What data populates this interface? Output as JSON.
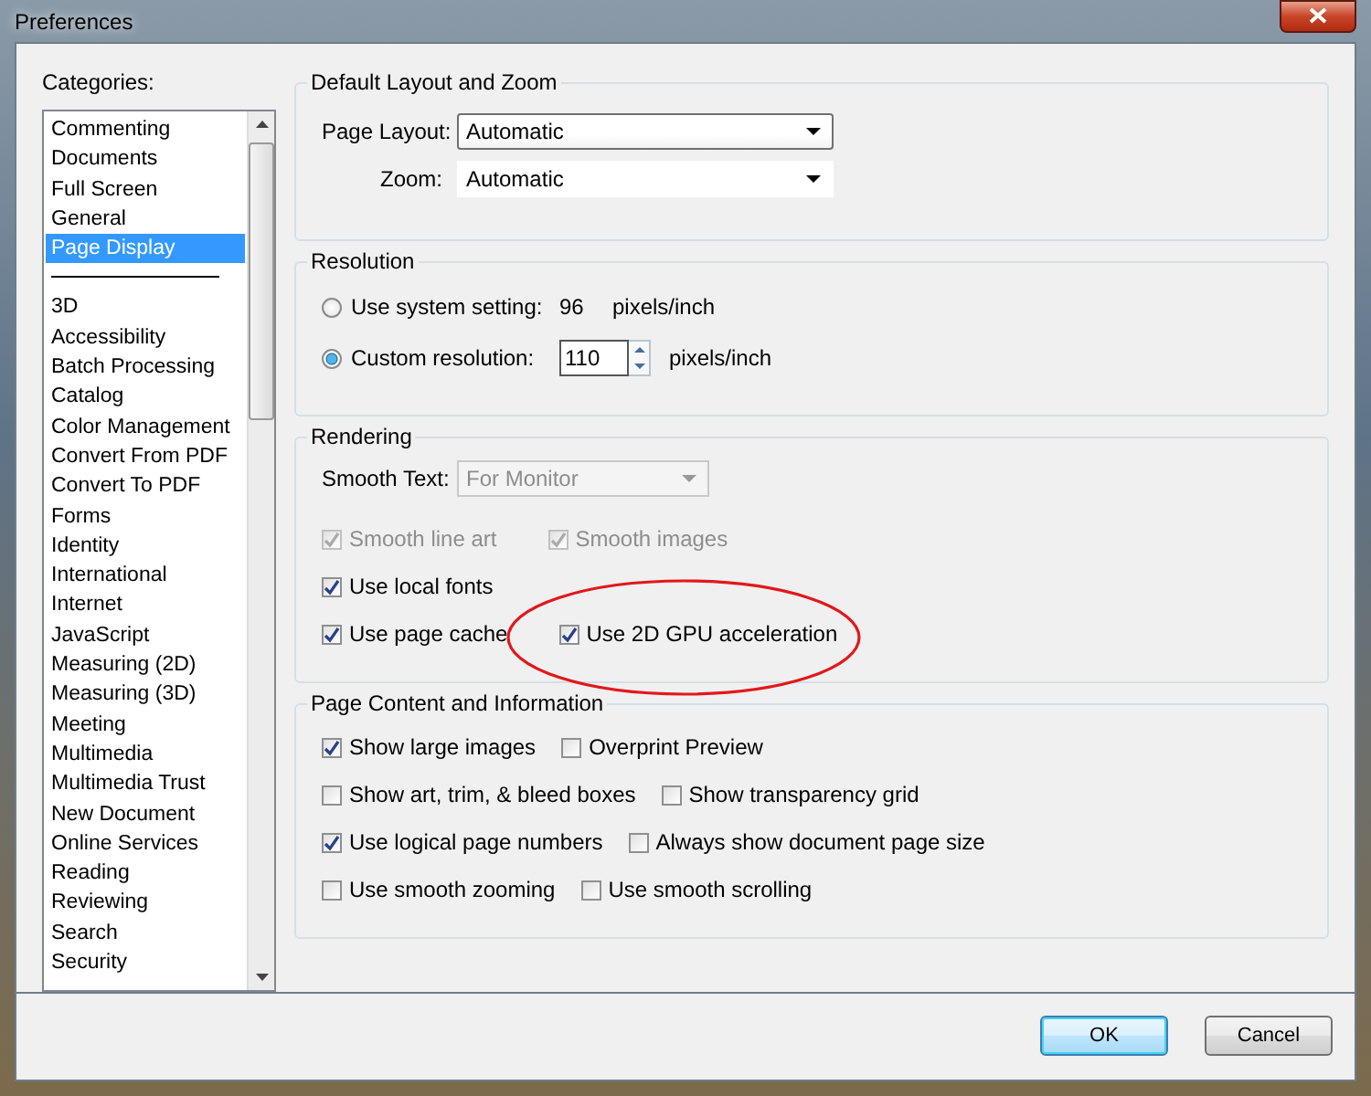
{
  "window": {
    "title": "Preferences"
  },
  "categories": {
    "label": "Categories:",
    "items": [
      {
        "kind": "item",
        "label": "Commenting",
        "selected": false
      },
      {
        "kind": "item",
        "label": "Documents",
        "selected": false
      },
      {
        "kind": "item",
        "label": "Full Screen",
        "selected": false
      },
      {
        "kind": "item",
        "label": "General",
        "selected": false
      },
      {
        "kind": "item",
        "label": "Page Display",
        "selected": true
      },
      {
        "kind": "separator"
      },
      {
        "kind": "item",
        "label": "3D",
        "selected": false
      },
      {
        "kind": "item",
        "label": "Accessibility",
        "selected": false
      },
      {
        "kind": "item",
        "label": "Batch Processing",
        "selected": false
      },
      {
        "kind": "item",
        "label": "Catalog",
        "selected": false
      },
      {
        "kind": "item",
        "label": "Color Management",
        "selected": false
      },
      {
        "kind": "item",
        "label": "Convert From PDF",
        "selected": false
      },
      {
        "kind": "item",
        "label": "Convert To PDF",
        "selected": false
      },
      {
        "kind": "item",
        "label": "Forms",
        "selected": false
      },
      {
        "kind": "item",
        "label": "Identity",
        "selected": false
      },
      {
        "kind": "item",
        "label": "International",
        "selected": false
      },
      {
        "kind": "item",
        "label": "Internet",
        "selected": false
      },
      {
        "kind": "item",
        "label": "JavaScript",
        "selected": false
      },
      {
        "kind": "item",
        "label": "Measuring (2D)",
        "selected": false
      },
      {
        "kind": "item",
        "label": "Measuring (3D)",
        "selected": false
      },
      {
        "kind": "item",
        "label": "Meeting",
        "selected": false
      },
      {
        "kind": "item",
        "label": "Multimedia",
        "selected": false
      },
      {
        "kind": "item",
        "label": "Multimedia Trust",
        "selected": false
      },
      {
        "kind": "item",
        "label": "New Document",
        "selected": false
      },
      {
        "kind": "item",
        "label": "Online Services",
        "selected": false
      },
      {
        "kind": "item",
        "label": "Reading",
        "selected": false
      },
      {
        "kind": "item",
        "label": "Reviewing",
        "selected": false
      },
      {
        "kind": "item",
        "label": "Search",
        "selected": false
      },
      {
        "kind": "item",
        "label": "Security",
        "selected": false
      }
    ]
  },
  "layout": {
    "title": "Default Layout and Zoom",
    "fields": [
      {
        "label": "Page Layout:",
        "value": "Automatic",
        "focused": true
      },
      {
        "label": "Zoom:",
        "value": "Automatic",
        "focused": false
      }
    ]
  },
  "resolution": {
    "title": "Resolution",
    "options": [
      {
        "kind": "static",
        "label": "Use system setting:",
        "selected": false,
        "value": "96",
        "unit": "pixels/inch"
      },
      {
        "kind": "spinner",
        "label": "Custom resolution:",
        "selected": true,
        "value": "110",
        "unit": "pixels/inch"
      }
    ]
  },
  "rendering": {
    "title": "Rendering",
    "smooth_text": {
      "label": "Smooth Text:",
      "value": "For Monitor",
      "disabled": true
    },
    "rows": [
      [
        {
          "label": "Smooth line art",
          "checked": true,
          "disabled": true
        },
        {
          "label": "Smooth images",
          "checked": true,
          "disabled": true
        }
      ],
      [
        {
          "label": "Use local fonts",
          "checked": true,
          "disabled": false
        }
      ],
      [
        {
          "label": "Use page cache",
          "checked": true,
          "disabled": false
        },
        {
          "label": "Use 2D GPU acceleration",
          "checked": true,
          "disabled": false,
          "circled": true
        }
      ]
    ]
  },
  "content": {
    "title": "Page Content and Information",
    "rows": [
      [
        {
          "label": "Show large images",
          "checked": true
        },
        {
          "label": "Overprint Preview",
          "checked": false
        }
      ],
      [
        {
          "label": "Show art, trim, & bleed boxes",
          "checked": false
        },
        {
          "label": "Show transparency grid",
          "checked": false
        }
      ],
      [
        {
          "label": "Use logical page numbers",
          "checked": true
        },
        {
          "label": "Always show document page size",
          "checked": false
        }
      ],
      [
        {
          "label": "Use smooth zooming",
          "checked": false
        },
        {
          "label": "Use smooth scrolling",
          "checked": false
        }
      ]
    ]
  },
  "buttons": [
    {
      "label": "OK",
      "default": true
    },
    {
      "label": "Cancel",
      "default": false
    }
  ]
}
